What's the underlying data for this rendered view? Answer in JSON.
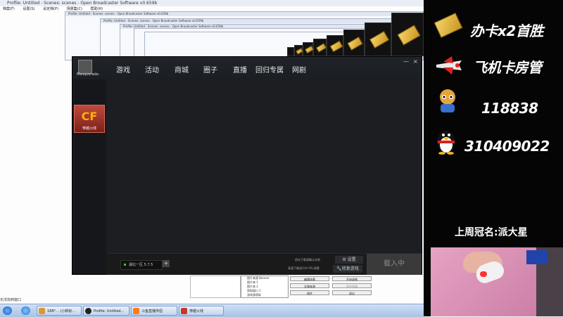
{
  "obs": {
    "title": "Profile: Untitled - Scenes: scenes - Open Broadcaster Software v0.659b",
    "menu": [
      "档案(F)",
      "设置(S)",
      "设定档(P)",
      "场景集(C)",
      "帮助(H)"
    ],
    "scene_items": [
      "图片来源 Banner",
      "图片来 1",
      "图片来 2",
      "获取窗口 1",
      "游戏源获取"
    ],
    "buttons": {
      "edit_scene": "编辑场景",
      "start_record": "开始录制",
      "global_source": "全域来源",
      "preview": "预览直播",
      "plugins": "插件",
      "exit": "退出"
    },
    "status": "无法找到窗口"
  },
  "client": {
    "username": "Masquerade.",
    "tabs": [
      "游戏",
      "活动",
      "商城",
      "圈子",
      "直播",
      "回归专属",
      "网剧"
    ],
    "game_label": "穿越火线",
    "server": "湖北一区 5.7.5",
    "server_add": "+",
    "download_line1": "首次下载请确认本地",
    "download_line2": "高速下载进行中 0% 顾客",
    "settings": "设置",
    "repair": "修复游戏",
    "start": "载入中",
    "close": "×",
    "minimize": "—"
  },
  "taskbar": {
    "items": [
      "188*... (小新标...",
      "Profile: Untitled...",
      "斗鱼直播伴侣",
      "穿越火线"
    ]
  },
  "panel": {
    "rows": [
      "办卡x2首胜",
      "飞机卡房管",
      "118838",
      "310409022"
    ],
    "last_week": "上周冠名:派大星"
  },
  "colors": {
    "client_bg": "#1a1c20",
    "cf_tile": "#a83628",
    "panel_bg": "#050505",
    "gold": "#f6d36a"
  }
}
